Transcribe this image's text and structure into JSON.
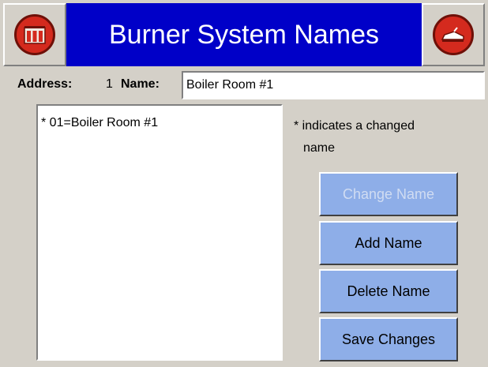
{
  "window": {
    "title": "Burner System Names"
  },
  "form": {
    "address_label": "Address:",
    "address_value": "1",
    "name_label": "Name:",
    "name_value": "Boiler Room #1"
  },
  "list": {
    "items": [
      "* 01=Boiler Room #1"
    ]
  },
  "note": {
    "line1": "* indicates a changed",
    "line2": "name"
  },
  "buttons": {
    "change_name": "Change Name",
    "add_name": "Add Name",
    "delete_name": "Delete Name",
    "save_changes": "Save Changes"
  },
  "icons": {
    "left": "boiler-icon",
    "right": "exit-icon"
  },
  "colors": {
    "title_bar": "#0000c8",
    "button": "#8eaee8",
    "icon_red": "#d42a1e",
    "background": "#d4d0c8"
  }
}
